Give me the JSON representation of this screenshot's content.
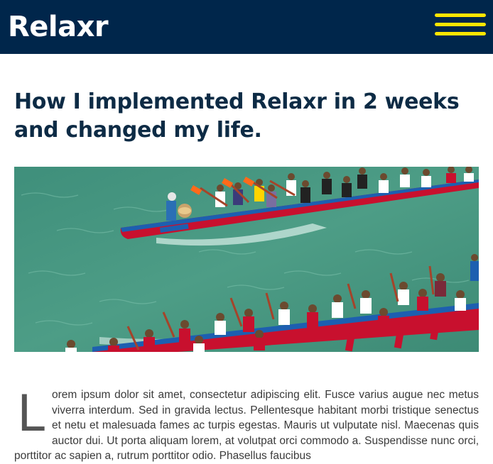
{
  "header": {
    "logo_text": "Relaxr",
    "menu_icon": "hamburger-menu-icon",
    "background_color": "#00264b",
    "accent_color": "#ffe500"
  },
  "article": {
    "title": "How I implemented Relaxr in 2 weeks and changed my life.",
    "hero_image_icon": "dragon-boat-race-photo",
    "drop_cap": "L",
    "body": "orem ipsum dolor sit amet, consectetur adipiscing elit. Fusce varius augue nec metus viverra interdum. Sed in gravida lectus. Pellentesque habitant morbi tristique senectus et netu et malesuada fames ac turpis egestas. Mauris ut vulputate nisl. Maecenas quis auctor dui. Ut porta aliquam lorem, at volutpat orci commodo a. Suspendisse nunc orci, porttitor ac sapien a, rutrum porttitor odio. Phasellus faucibus"
  }
}
